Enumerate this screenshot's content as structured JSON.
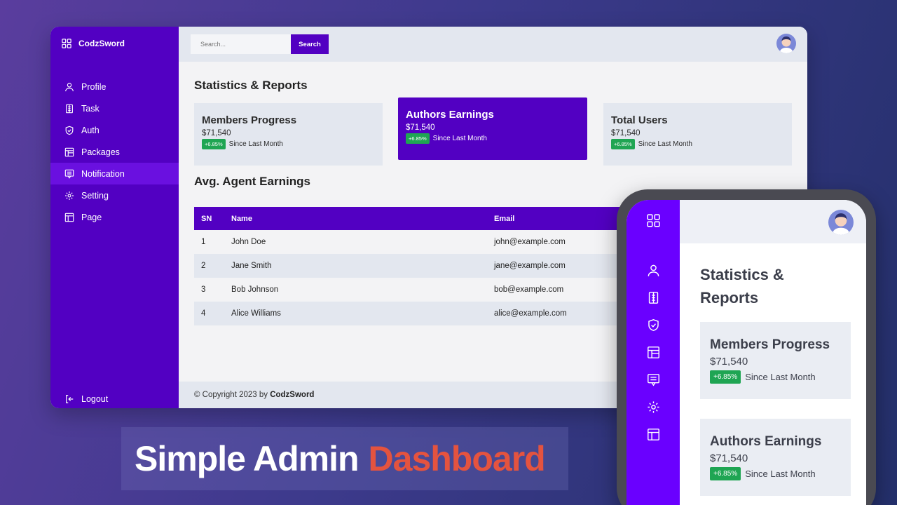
{
  "app": {
    "brand": "CodzSword"
  },
  "sidebar": {
    "items": [
      {
        "label": "Profile",
        "icon": "user-icon"
      },
      {
        "label": "Task",
        "icon": "task-icon"
      },
      {
        "label": "Auth",
        "icon": "shield-icon"
      },
      {
        "label": "Packages",
        "icon": "packages-icon"
      },
      {
        "label": "Notification",
        "icon": "notification-icon",
        "active": true
      },
      {
        "label": "Setting",
        "icon": "gear-icon"
      },
      {
        "label": "Page",
        "icon": "page-icon"
      }
    ],
    "logout": "Logout"
  },
  "search": {
    "placeholder": "Search...",
    "button": "Search"
  },
  "main": {
    "stats_title": "Statistics & Reports",
    "cards": [
      {
        "title": "Members Progress",
        "value": "$71,540",
        "badge": "+6.85%",
        "note": "Since Last Month"
      },
      {
        "title": "Authors Earnings",
        "value": "$71,540",
        "badge": "+6.85%",
        "note": "Since Last Month"
      },
      {
        "title": "Total Users",
        "value": "$71,540",
        "badge": "+6.85%",
        "note": "Since Last Month"
      }
    ],
    "earnings_title": "Avg. Agent Earnings",
    "table": {
      "headers": [
        "SN",
        "Name",
        "Email"
      ],
      "rows": [
        [
          "1",
          "John Doe",
          "john@example.com"
        ],
        [
          "2",
          "Jane Smith",
          "jane@example.com"
        ],
        [
          "3",
          "Bob Johnson",
          "bob@example.com"
        ],
        [
          "4",
          "Alice Williams",
          "alice@example.com"
        ]
      ]
    },
    "footer": {
      "prefix": "© Copyright 2023 by ",
      "brand": "CodzSword"
    }
  },
  "phone": {
    "title": "Statistics & Reports",
    "cards": [
      {
        "title": "Members Progress",
        "value": "$71,540",
        "badge": "+6.85%",
        "note": "Since Last Month"
      },
      {
        "title": "Authors Earnings",
        "value": "$71,540",
        "badge": "+6.85%",
        "note": "Since Last Month"
      }
    ]
  },
  "banner": {
    "white": "Simple Admin",
    "accent": "Dashboard"
  },
  "colors": {
    "primary": "#5200c2",
    "phone_sidebar": "#6a00ff",
    "badge": "#1fa553",
    "accent": "#e4533f"
  }
}
